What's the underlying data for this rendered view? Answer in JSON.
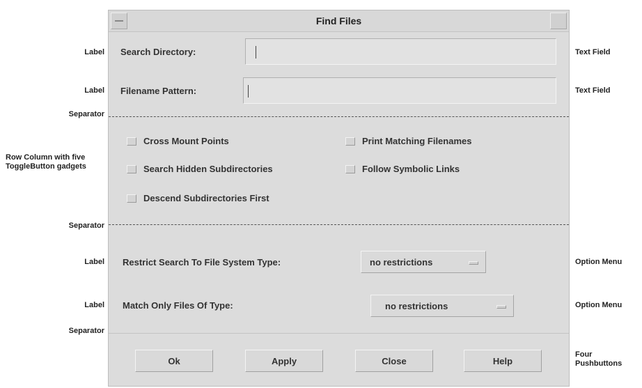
{
  "window": {
    "title": "Find Files"
  },
  "annotations": {
    "label_1": "Label",
    "text_field_1": "Text Field",
    "label_2": "Label",
    "text_field_2": "Text Field",
    "separator_1": "Separator",
    "row_column": "Row Column with five ToggleButton gadgets",
    "separator_2": "Separator",
    "label_3": "Label",
    "option_menu_1": "Option Menu",
    "label_4": "Label",
    "option_menu_2": "Option Menu",
    "separator_3": "Separator",
    "pushbuttons": "Four Pushbuttons"
  },
  "form": {
    "search_directory_label": "Search Directory:",
    "search_directory_value": "",
    "filename_pattern_label": "Filename Pattern:",
    "filename_pattern_value": ""
  },
  "toggles": [
    {
      "label": "Cross Mount Points",
      "checked": false
    },
    {
      "label": "Print Matching Filenames",
      "checked": false
    },
    {
      "label": "Search Hidden Subdirectories",
      "checked": false
    },
    {
      "label": "Follow Symbolic Links",
      "checked": false
    },
    {
      "label": "Descend Subdirectories First",
      "checked": false
    }
  ],
  "options": {
    "restrict_label": "Restrict Search To File System Type:",
    "restrict_value": "no restrictions",
    "match_label": "Match Only Files Of Type:",
    "match_value": "no restrictions"
  },
  "buttons": {
    "ok": "Ok",
    "apply": "Apply",
    "close": "Close",
    "help": "Help"
  }
}
